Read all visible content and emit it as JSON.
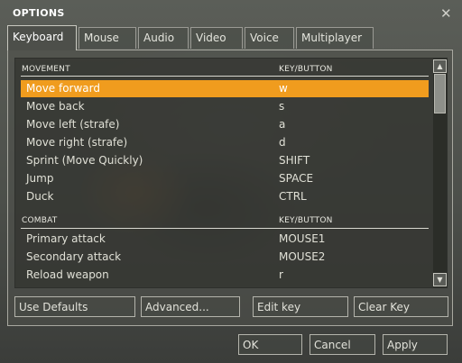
{
  "dialog": {
    "title": "OPTIONS",
    "close_icon": "close-icon"
  },
  "tabs": [
    {
      "label": "Keyboard",
      "active": true
    },
    {
      "label": "Mouse"
    },
    {
      "label": "Audio"
    },
    {
      "label": "Video"
    },
    {
      "label": "Voice"
    },
    {
      "label": "Multiplayer"
    }
  ],
  "sections": [
    {
      "header": "MOVEMENT",
      "column_header": "KEY/BUTTON",
      "rows": [
        {
          "action": "Move forward",
          "key": "w",
          "selected": true
        },
        {
          "action": "Move back",
          "key": "s"
        },
        {
          "action": "Move left (strafe)",
          "key": "a"
        },
        {
          "action": "Move right (strafe)",
          "key": "d"
        },
        {
          "action": "Sprint (Move Quickly)",
          "key": "SHIFT"
        },
        {
          "action": "Jump",
          "key": "SPACE"
        },
        {
          "action": "Duck",
          "key": "CTRL"
        }
      ]
    },
    {
      "header": "COMBAT",
      "column_header": "KEY/BUTTON",
      "rows": [
        {
          "action": "Primary attack",
          "key": "MOUSE1"
        },
        {
          "action": "Secondary attack",
          "key": "MOUSE2"
        },
        {
          "action": "Reload weapon",
          "key": "r"
        }
      ]
    }
  ],
  "buttons": {
    "use_defaults": "Use Defaults",
    "advanced": "Advanced...",
    "edit_key": "Edit key",
    "clear_key": "Clear Key",
    "ok": "OK",
    "cancel": "Cancel",
    "apply": "Apply"
  },
  "colors": {
    "selection": "#f09c1e",
    "text": "#dcdcd0"
  }
}
